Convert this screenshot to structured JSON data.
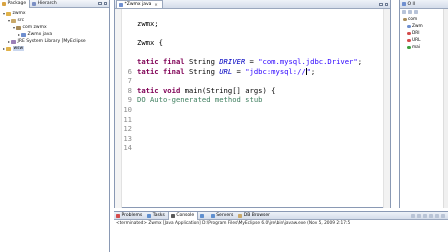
{
  "package_explorer": {
    "tabs": [
      {
        "label": "Package",
        "color": "#d9a441"
      },
      {
        "label": "Hierarch",
        "color": "#7b8fc4"
      }
    ],
    "tree": [
      {
        "indent": 0,
        "twisty": "▾",
        "icon_color": "#e0b24a",
        "label": "zwmx"
      },
      {
        "indent": 1,
        "twisty": "▾",
        "icon_color": "#c9a96a",
        "label": "src"
      },
      {
        "indent": 2,
        "twisty": "▾",
        "icon_color": "#a88c5a",
        "label": "com zwmx"
      },
      {
        "indent": 3,
        "twisty": "▸",
        "icon_color": "#6f8fcf",
        "label": "Zwmx java"
      },
      {
        "indent": 1,
        "twisty": "▸",
        "icon_color": "#9a7fb8",
        "label": "JRE System Library [MyEclipse"
      },
      {
        "indent": 0,
        "twisty": "▸",
        "icon_color": "#e0b24a",
        "label": "wsw",
        "selected": true
      }
    ]
  },
  "editor": {
    "tab_label": "*Zwmx java",
    "close_label": "✕",
    "lines": [
      {
        "num": "",
        "parts": [
          {
            "t": "",
            "c": "txt"
          }
        ]
      },
      {
        "num": "",
        "parts": [
          {
            "t": "zwmx;",
            "c": "txt"
          }
        ]
      },
      {
        "num": "",
        "parts": [
          {
            "t": "",
            "c": "txt"
          }
        ]
      },
      {
        "num": "",
        "parts": [
          {
            "t": "Zwmx {",
            "c": "txt"
          }
        ]
      },
      {
        "num": "",
        "parts": [
          {
            "t": "",
            "c": "txt"
          }
        ]
      },
      {
        "num": "",
        "parts": [
          {
            "t": "tatic final ",
            "c": "kw"
          },
          {
            "t": "String ",
            "c": "txt"
          },
          {
            "t": "DRIVER",
            "c": "fld"
          },
          {
            "t": " = ",
            "c": "txt"
          },
          {
            "t": "\"com.mysql.jdbc.Driver\"",
            "c": "str"
          },
          {
            "t": ";",
            "c": "txt"
          }
        ]
      },
      {
        "num": "6",
        "parts": [
          {
            "t": "tatic final ",
            "c": "kw"
          },
          {
            "t": "String ",
            "c": "txt"
          },
          {
            "t": "URL",
            "c": "fld"
          },
          {
            "t": " = ",
            "c": "txt"
          },
          {
            "t": "\"jdbc:mysql://",
            "c": "str"
          },
          {
            "t": "|",
            "c": "cursor"
          },
          {
            "t": "\"",
            "c": "str"
          },
          {
            "t": ";",
            "c": "txt"
          }
        ]
      },
      {
        "num": "7",
        "parts": [
          {
            "t": "",
            "c": "txt"
          }
        ]
      },
      {
        "num": "8",
        "parts": [
          {
            "t": "tatic void ",
            "c": "kw"
          },
          {
            "t": "main(String[] args) {",
            "c": "txt"
          }
        ]
      },
      {
        "num": "9",
        "parts": [
          {
            "t": "DO Auto-generated method stub",
            "c": "cmt"
          }
        ]
      },
      {
        "num": "10",
        "parts": [
          {
            "t": "",
            "c": "txt"
          }
        ]
      },
      {
        "num": "11",
        "parts": [
          {
            "t": "",
            "c": "txt"
          }
        ]
      },
      {
        "num": "12",
        "parts": [
          {
            "t": "",
            "c": "txt"
          }
        ]
      },
      {
        "num": "13",
        "parts": [
          {
            "t": "",
            "c": "txt"
          }
        ]
      },
      {
        "num": "14",
        "parts": [
          {
            "t": "",
            "c": "txt"
          }
        ]
      }
    ]
  },
  "outline": {
    "tab_label": "O ll",
    "items": [
      {
        "label": "com",
        "color": "#a88c5a"
      },
      {
        "label": "Zwm",
        "color": "#6f8fcf"
      },
      {
        "label": "DRI",
        "color": "#d44b4b"
      },
      {
        "label": "URL",
        "color": "#d44b4b"
      },
      {
        "label": "mai",
        "color": "#3f9f3f"
      }
    ]
  },
  "console": {
    "tabs": [
      {
        "label": "Problems",
        "color": "#d44b4b",
        "active": false
      },
      {
        "label": "Tasks",
        "color": "#5f8fcf",
        "active": false
      },
      {
        "label": "Console",
        "color": "#5a5a5a",
        "active": true
      },
      {
        "label": "",
        "color": "#5f8fcf",
        "active": false
      },
      {
        "label": "Servers",
        "color": "#5f8fcf",
        "active": false
      },
      {
        "label": "DB Browser",
        "color": "#c9a96a",
        "active": false
      }
    ],
    "terminated_text": "<terminated> Zwmx [Java Application] D:\\Program Files\\MyEclipse 6.0\\jre\\bin\\javaw.exe (Nov 5, 2009 2:17:5"
  }
}
